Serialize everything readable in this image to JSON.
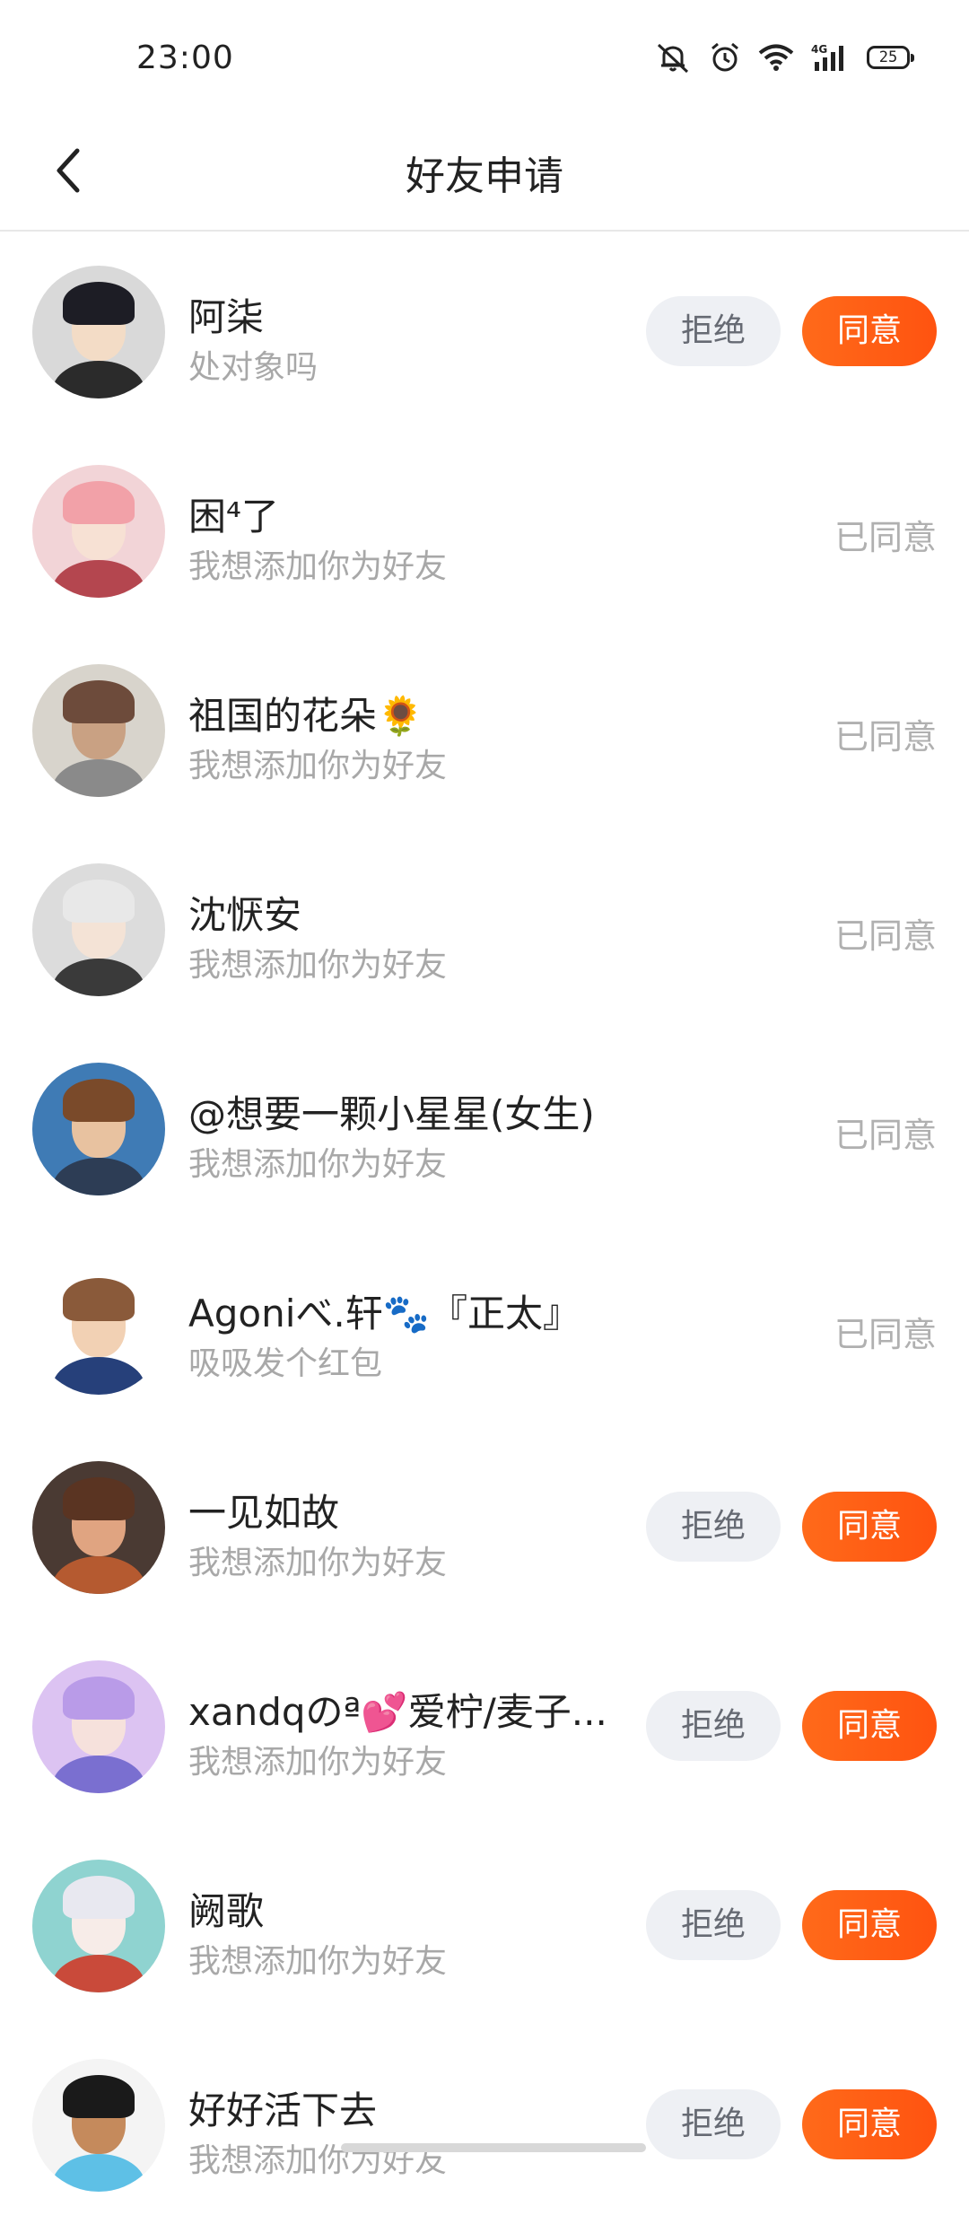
{
  "status_bar": {
    "time": "23:00",
    "battery": "25",
    "icons": [
      "mute-bell-icon",
      "alarm-icon",
      "wifi-icon",
      "4g-signal-icon",
      "battery-icon"
    ]
  },
  "header": {
    "title": "好友申请",
    "back_icon": "chevron-left-icon"
  },
  "labels": {
    "reject": "拒绝",
    "accept": "同意",
    "accepted": "已同意"
  },
  "requests": [
    {
      "name": "阿柒",
      "message": "处对象吗",
      "state": "pending",
      "avatar_colors": [
        "#d9d9d9",
        "#f3dcc6",
        "#1d1d25",
        "#2b2b2b"
      ]
    },
    {
      "name": "困⁴了",
      "message": "我想添加你为好友",
      "state": "accepted",
      "avatar_colors": [
        "#f2d4d7",
        "#f7e1d4",
        "#f2a1a8",
        "#b4464f"
      ]
    },
    {
      "name": "祖国的花朵🌻",
      "message": "我想添加你为好友",
      "state": "accepted",
      "avatar_colors": [
        "#d8d4cc",
        "#c9a183",
        "#6d4b3b",
        "#8a8a8a"
      ]
    },
    {
      "name": "沈恹安",
      "message": "我想添加你为好友",
      "state": "accepted",
      "avatar_colors": [
        "#dcdcdc",
        "#f4e3d6",
        "#e8e8e8",
        "#3a3a3a"
      ]
    },
    {
      "name": "@想要一颗小星星(女生)",
      "message": "我想添加你为好友",
      "state": "accepted",
      "avatar_colors": [
        "#3f7bb5",
        "#e8c2a0",
        "#7a4a2a",
        "#2d3d55"
      ]
    },
    {
      "name": "Agoniべ.轩🐾『正太』",
      "message": "吸吸发个红包",
      "state": "accepted",
      "avatar_colors": [
        "#ffffff",
        "#f2d1b4",
        "#8a5a3a",
        "#26407a"
      ]
    },
    {
      "name": "一见如故",
      "message": "我想添加你为好友",
      "state": "pending",
      "avatar_colors": [
        "#4a3a33",
        "#e0a481",
        "#5a3422",
        "#b55a30"
      ]
    },
    {
      "name": "xandqのª💕爱柠/麦子...",
      "message": "我想添加你为好友",
      "state": "pending",
      "avatar_colors": [
        "#dcc3f2",
        "#f6e1dc",
        "#b99be8",
        "#7a6fd0"
      ]
    },
    {
      "name": "阙歌",
      "message": "我想添加你为好友",
      "state": "pending",
      "avatar_colors": [
        "#8fd3d0",
        "#f7ece8",
        "#e8e8f0",
        "#c94a3a"
      ]
    },
    {
      "name": "好好活下去",
      "message": "我想添加你为好友",
      "state": "pending",
      "avatar_colors": [
        "#f4f4f4",
        "#c58a5c",
        "#1a1a1a",
        "#5ec0e6"
      ]
    }
  ]
}
